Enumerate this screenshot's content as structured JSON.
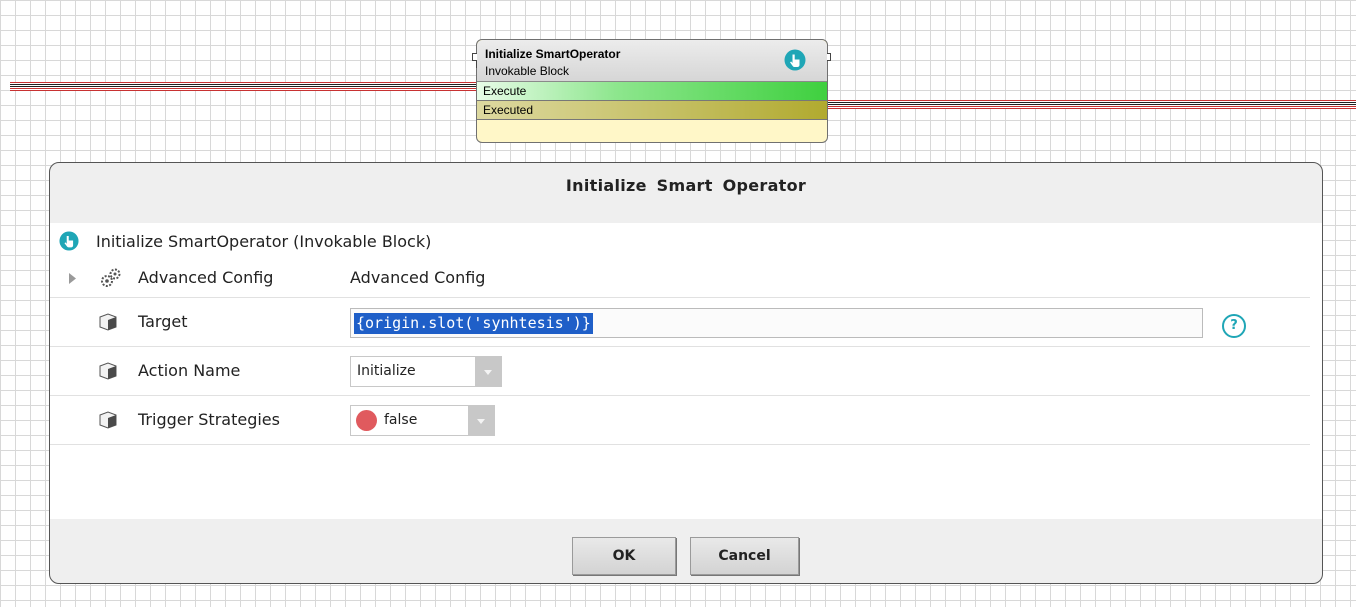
{
  "node": {
    "title": "Initialize SmartOperator",
    "subtitle": "Invokable Block",
    "slots": [
      "Execute",
      "Executed"
    ]
  },
  "dialog": {
    "title": "Initialize  Smart  Operator",
    "header_label": "Initialize SmartOperator  (Invokable Block)",
    "rows": {
      "advanced": {
        "label": "Advanced Config",
        "value": "Advanced Config"
      },
      "target": {
        "label": "Target",
        "value": "{origin.slot('synhtesis')}"
      },
      "action": {
        "label": "Action Name",
        "value": "Initialize"
      },
      "trigger": {
        "label": "Trigger Strategies",
        "value": "false"
      }
    },
    "buttons": {
      "ok": "OK",
      "cancel": "Cancel"
    },
    "help_glyph": "?"
  },
  "colors": {
    "accent": "#1fa6b6",
    "link_red": "#c83232",
    "execute_green": "#3fd03f",
    "executed_olive": "#b1aa2f",
    "false_dot": "#e05a5e",
    "selection": "#1f5fc8"
  },
  "icons": {
    "block": "hand-pointer-icon",
    "advanced": "gears-icon",
    "property": "cube-icon",
    "help": "question-circle-icon"
  }
}
